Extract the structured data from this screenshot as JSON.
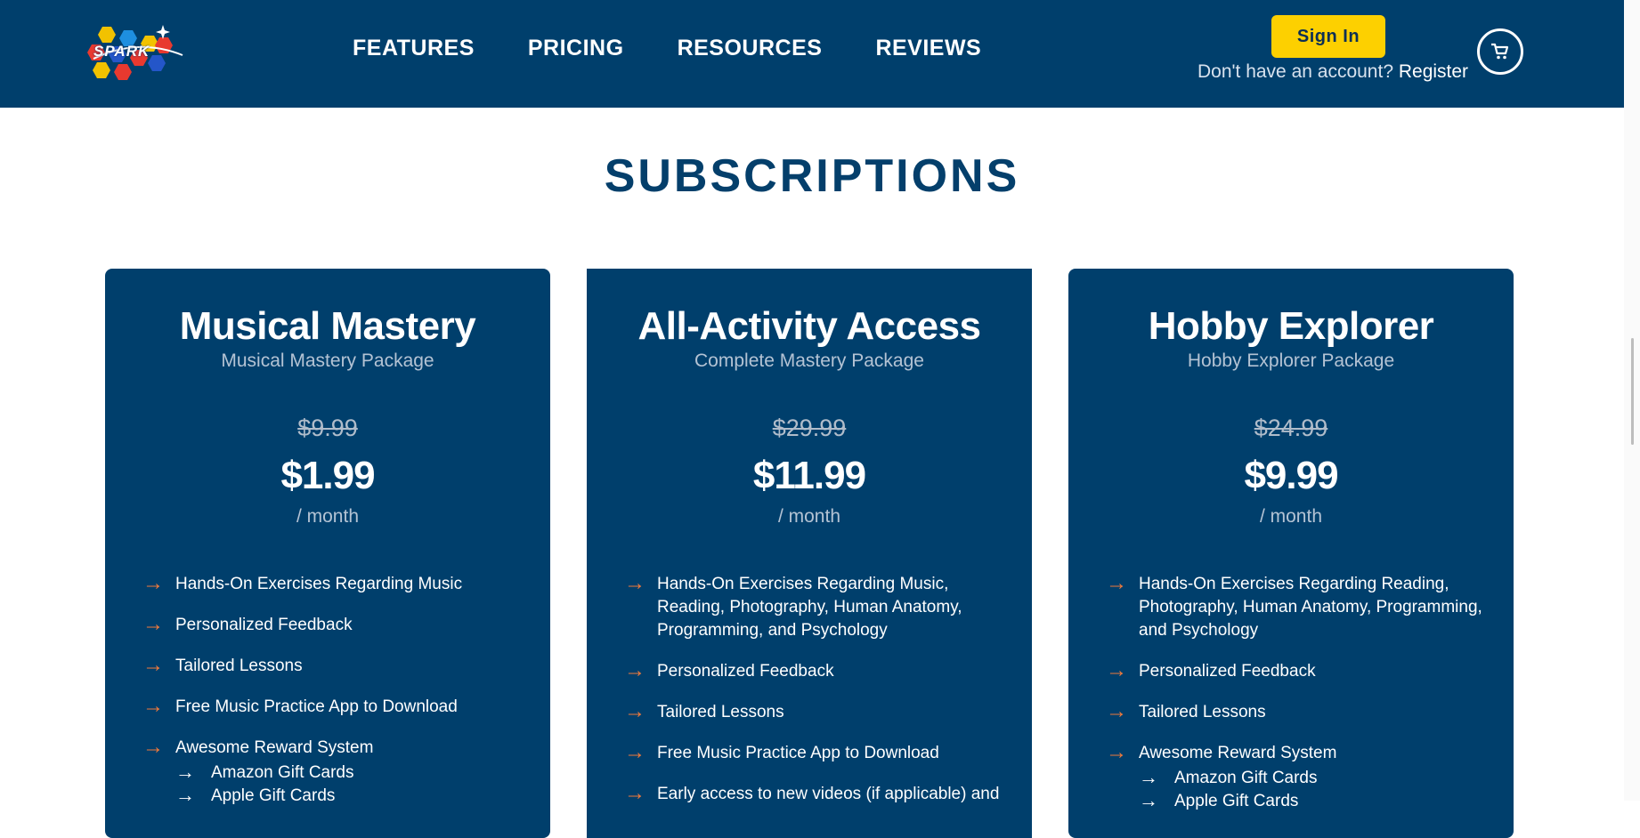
{
  "header": {
    "logo_text": "SPARK",
    "nav": [
      "FEATURES",
      "PRICING",
      "RESOURCES",
      "REVIEWS"
    ],
    "signin_label": "Sign In",
    "account_prompt": "Don't have an account?",
    "register_label": "Register",
    "cart_icon": "cart-icon"
  },
  "section_title": "SUBSCRIPTIONS",
  "colors": {
    "header_bg": "#003f6c",
    "card_bg": "#003f6c",
    "accent_yellow": "#fdd000",
    "arrow_orange": "#f07a3c",
    "title_blue": "#043f6b"
  },
  "cards": [
    {
      "title": "Musical Mastery",
      "subtitle": "Musical Mastery Package",
      "old_price": "$9.99",
      "price": "$1.99",
      "per": "/ month",
      "features": [
        "Hands-On Exercises Regarding Music",
        "Personalized Feedback",
        "Tailored Lessons",
        "Free Music Practice App to Download",
        "Awesome Reward System"
      ],
      "subitems": [
        "Amazon Gift Cards",
        "Apple Gift Cards"
      ]
    },
    {
      "title": "All-Activity Access",
      "subtitle": "Complete Mastery Package",
      "old_price": "$29.99",
      "price": "$11.99",
      "per": "/ month",
      "features": [
        "Hands-On Exercises Regarding Music, Reading, Photography, Human Anatomy, Programming, and Psychology",
        "Personalized Feedback",
        "Tailored Lessons",
        "Free Music Practice App to Download",
        "Early access to new videos (if applicable) and"
      ]
    },
    {
      "title": "Hobby Explorer",
      "subtitle": "Hobby Explorer Package",
      "old_price": "$24.99",
      "price": "$9.99",
      "per": "/ month",
      "features": [
        "Hands-On Exercises Regarding Reading, Photography, Human Anatomy, Programming, and Psychology",
        "Personalized Feedback",
        "Tailored Lessons",
        "Awesome Reward System"
      ],
      "subitems": [
        "Amazon Gift Cards",
        "Apple Gift Cards"
      ]
    }
  ]
}
